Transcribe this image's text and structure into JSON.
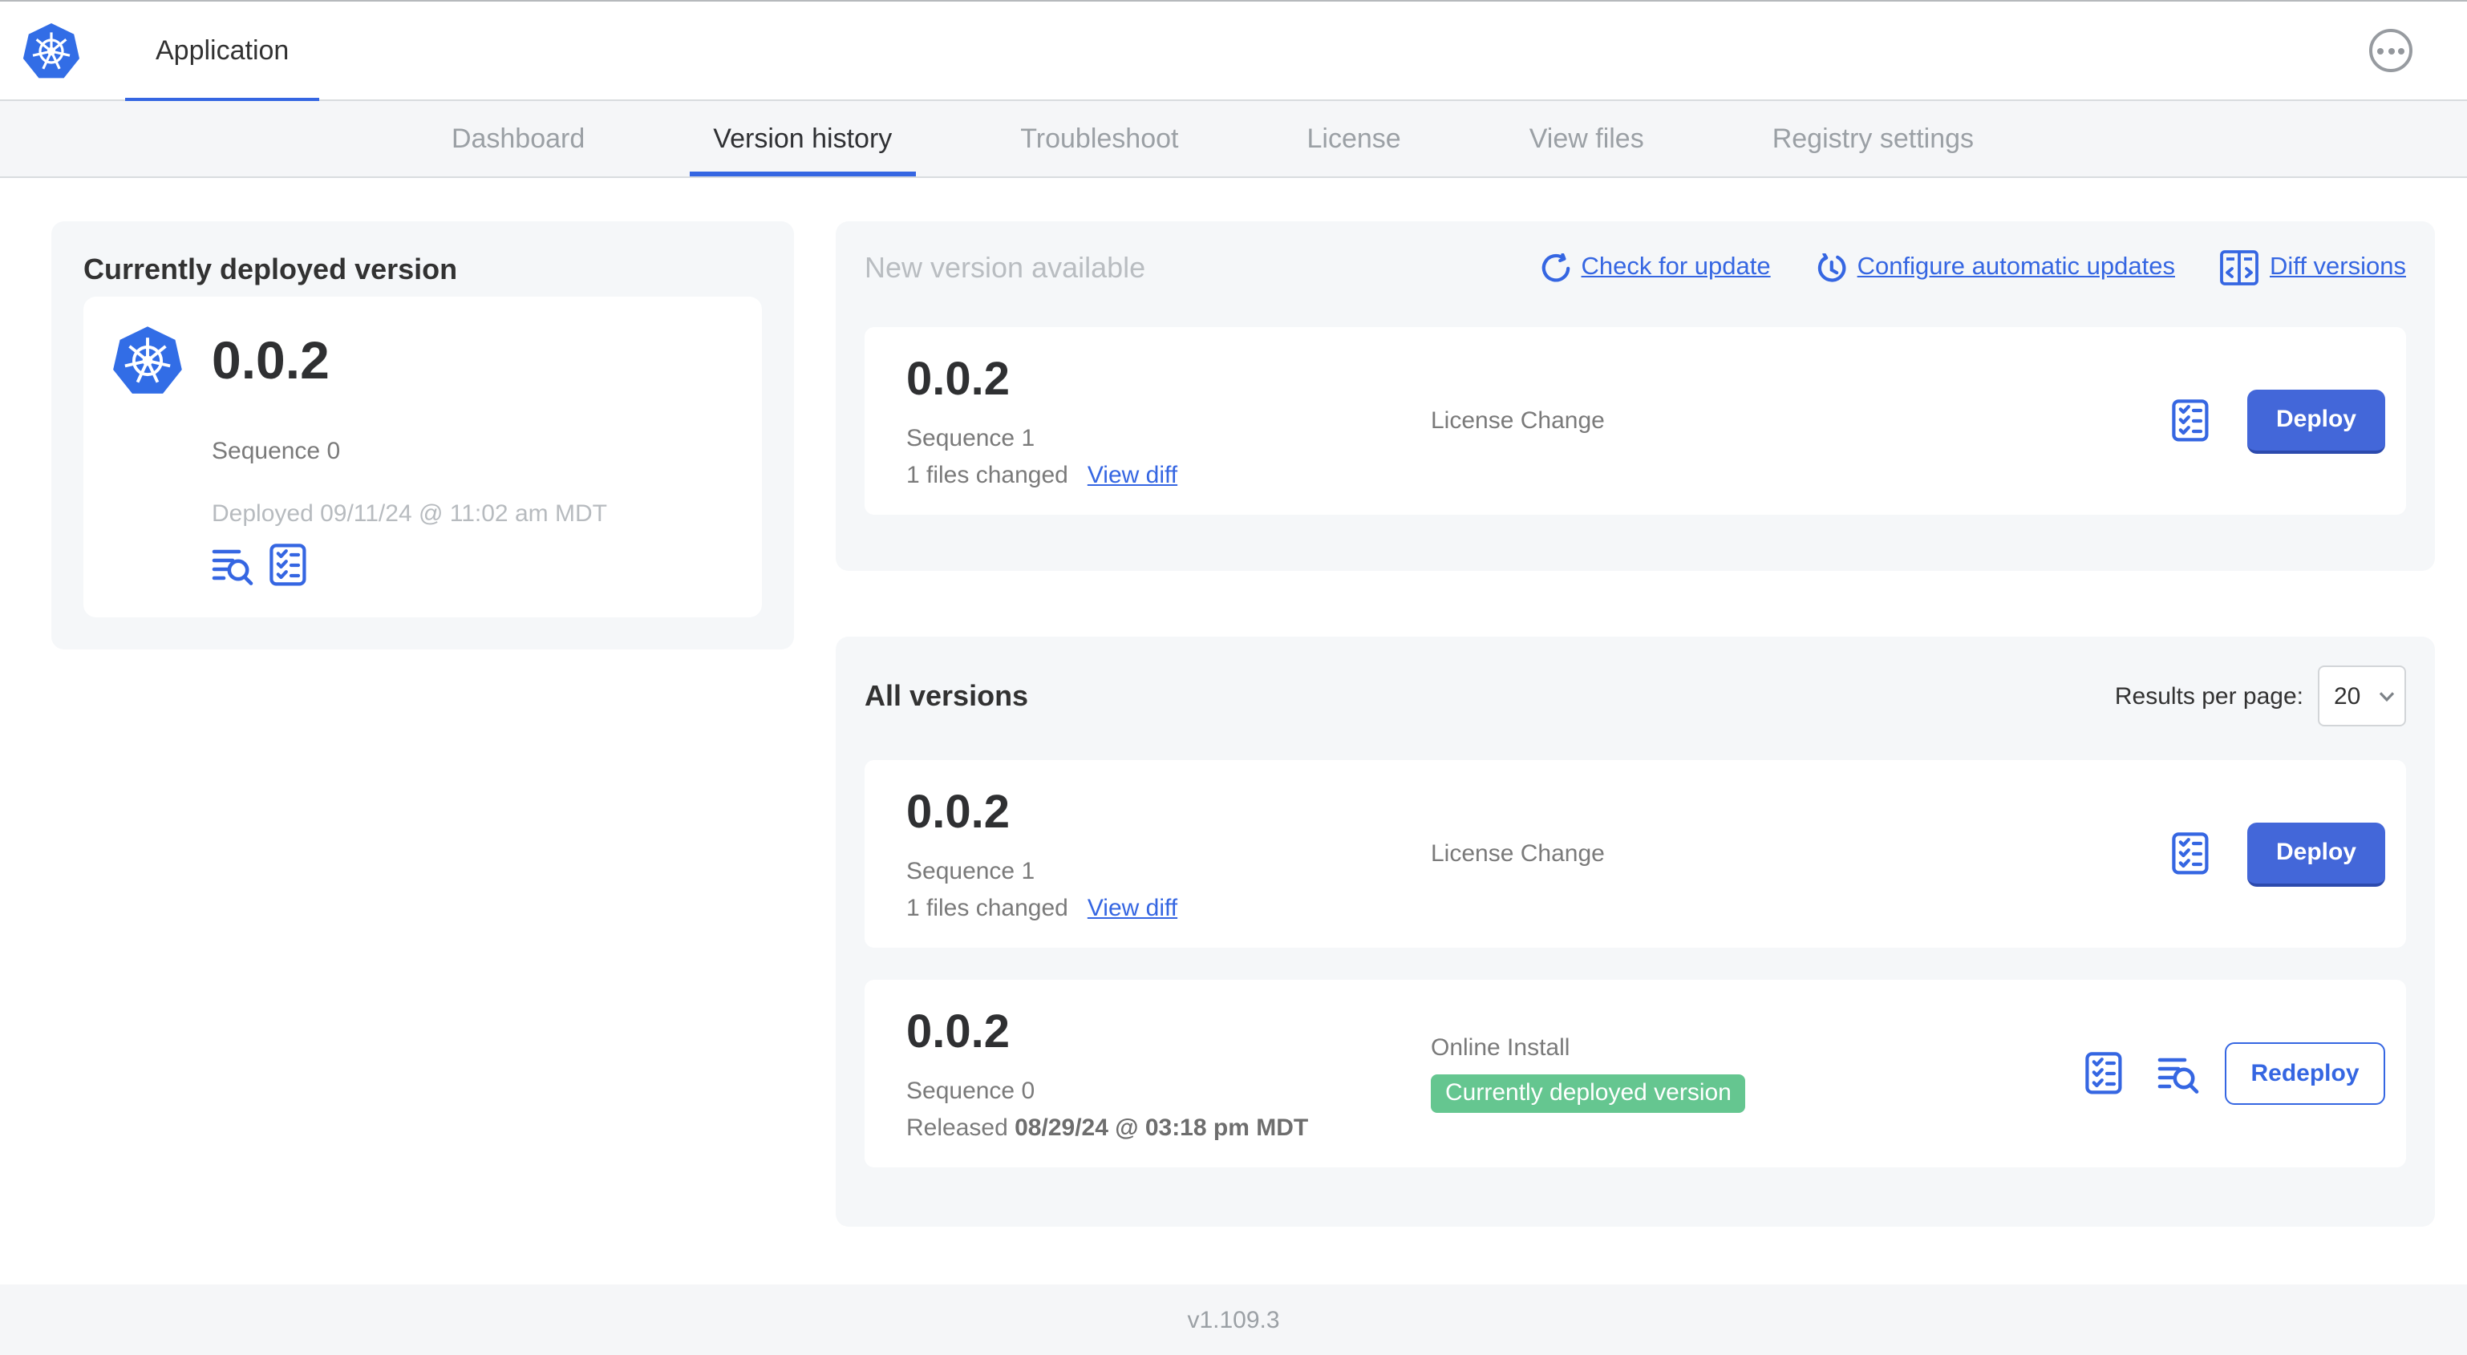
{
  "colors": {
    "accent_blue": "#3566e2",
    "button_blue": "#4367d9",
    "k8s_blue": "#326de6",
    "badge_green": "#65c690"
  },
  "header": {
    "app_title": "Application"
  },
  "nav": {
    "tabs": [
      {
        "label": "Dashboard",
        "active": false
      },
      {
        "label": "Version history",
        "active": true
      },
      {
        "label": "Troubleshoot",
        "active": false
      },
      {
        "label": "License",
        "active": false
      },
      {
        "label": "View files",
        "active": false
      },
      {
        "label": "Registry settings",
        "active": false
      }
    ]
  },
  "deployed_card": {
    "title": "Currently deployed version",
    "version": "0.0.2",
    "sequence": "Sequence 0",
    "deployed_at": "Deployed 09/11/24 @ 11:02 am MDT"
  },
  "new_version": {
    "title": "New version available",
    "check_for_update": "Check for update",
    "configure_updates": "Configure automatic updates",
    "diff_versions": "Diff versions",
    "row": {
      "version": "0.0.2",
      "sequence": "Sequence 1",
      "files_changed": "1 files changed",
      "view_diff": "View diff",
      "source": "License Change",
      "action_label": "Deploy"
    }
  },
  "all_versions": {
    "title": "All versions",
    "results_per_page_label": "Results per page:",
    "per_page_value": "20",
    "rows": [
      {
        "version": "0.0.2",
        "sequence": "Sequence 1",
        "files_changed": "1 files changed",
        "view_diff": "View diff",
        "source": "License Change",
        "action_label": "Deploy"
      },
      {
        "version": "0.0.2",
        "sequence": "Sequence 0",
        "released_prefix": "Released",
        "released_date": "08/29/24 @ 03:18 pm MDT",
        "source": "Online Install",
        "badge": "Currently deployed version",
        "action_label": "Redeploy"
      }
    ]
  },
  "footer": {
    "app_version": "v1.109.3"
  }
}
